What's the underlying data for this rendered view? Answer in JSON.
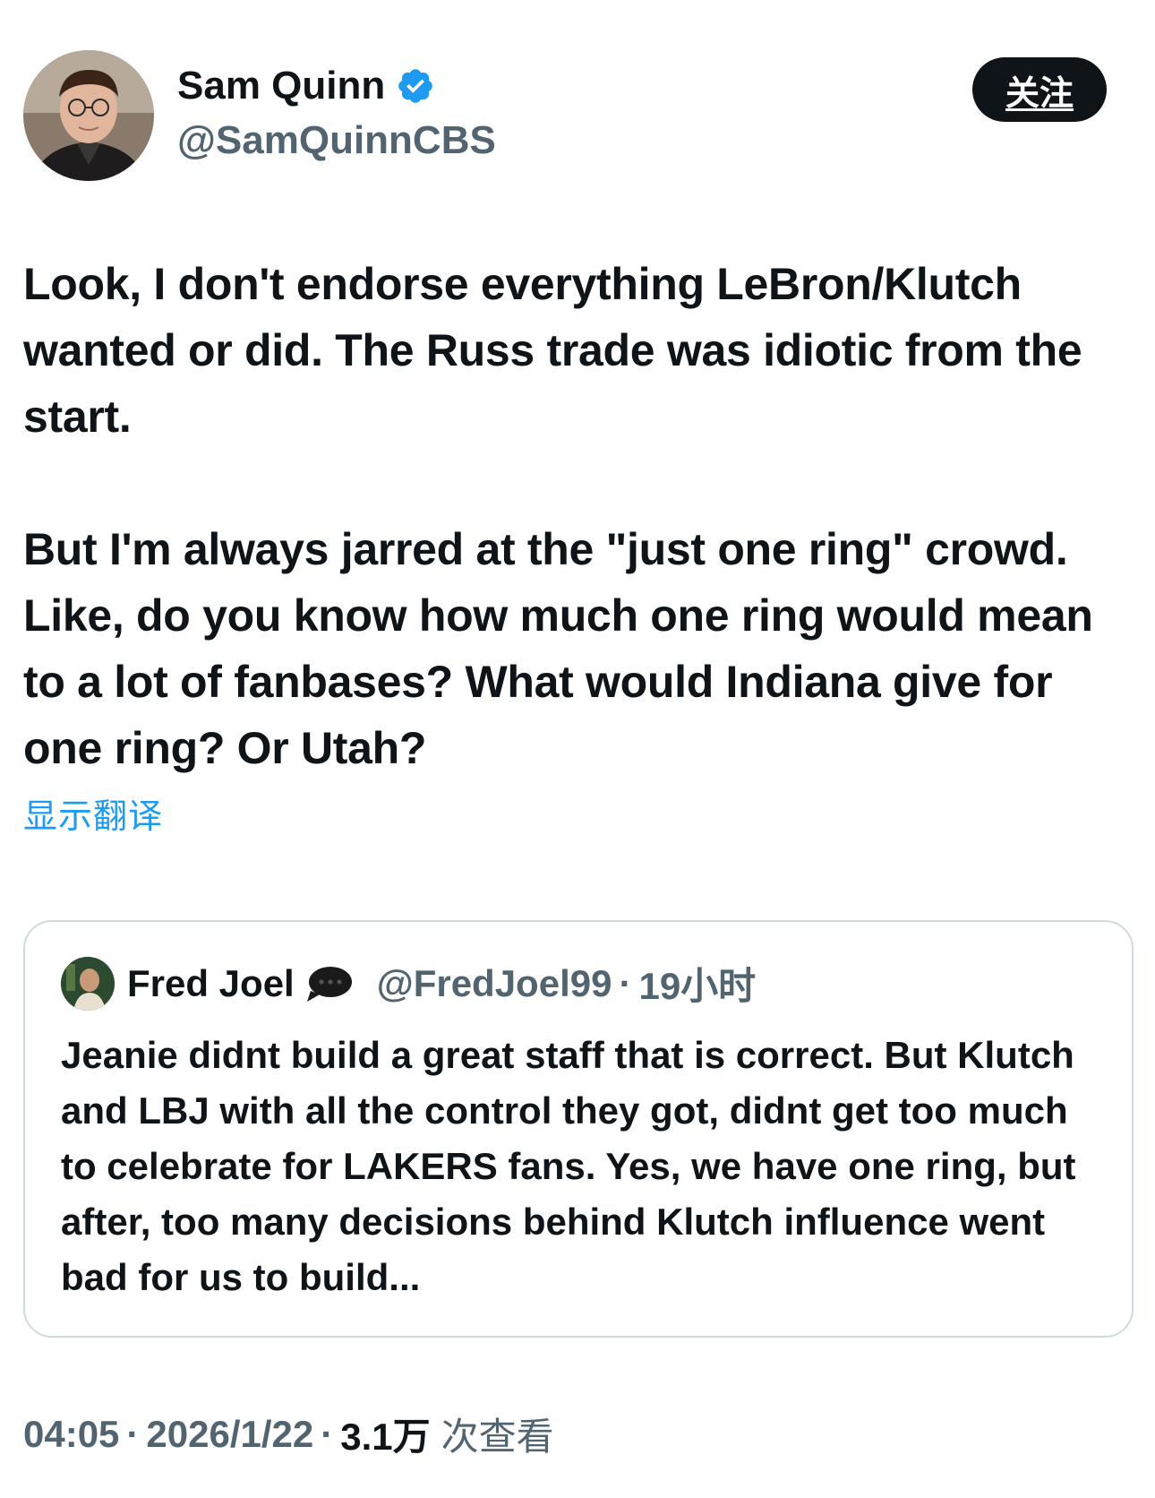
{
  "author": {
    "display_name": "Sam Quinn",
    "handle": "@SamQuinnCBS",
    "verified": true,
    "avatar_icon": "profile-photo"
  },
  "follow_button": {
    "label": "关注"
  },
  "tweet": {
    "paragraphs": [
      "Look, I don't endorse everything LeBron/Klutch wanted or did. The Russ trade was idiotic from the start.",
      "But I'm always jarred at the \"just one ring\" crowd. Like, do you know how much one ring would mean to a lot of fanbases? What would Indiana give for one ring? Or Utah?"
    ]
  },
  "translate_link": "显示翻译",
  "quoted_tweet": {
    "display_name": "Fred Joel",
    "name_emoji": "speech-bubble-icon",
    "handle": "@FredJoel99",
    "separator": "·",
    "time": "19小时",
    "text": "Jeanie didnt build a great staff that is correct. But Klutch and LBJ with all the control they got, didnt get too much to celebrate for LAKERS fans. Yes, we have one ring, but after, too many decisions behind Klutch influence went bad for us to build..."
  },
  "meta": {
    "time": "04:05",
    "separator": "·",
    "date": "2026/1/22",
    "views_count": "3.1万",
    "views_label": "次查看"
  },
  "colors": {
    "text_primary": "#0f1419",
    "text_secondary": "#536471",
    "accent": "#1d9bf0",
    "border": "#cfd9de",
    "button_bg": "#0f1419"
  }
}
